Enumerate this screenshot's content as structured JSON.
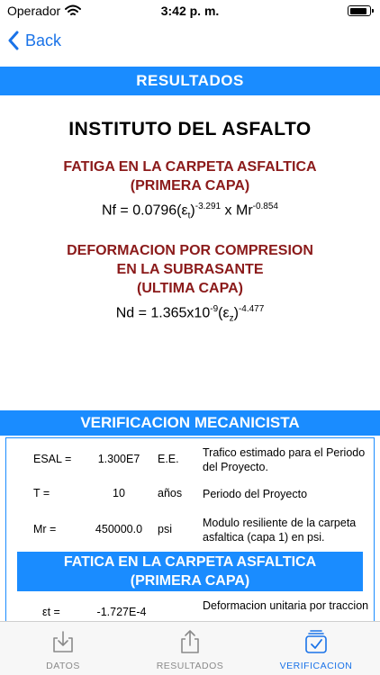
{
  "status": {
    "carrier": "Operador",
    "time": "3:42 p. m."
  },
  "nav": {
    "back_label": "Back"
  },
  "header": {
    "title": "RESULTADOS"
  },
  "content": {
    "institute": "INSTITUTO DEL ASFALTO",
    "fatigue": {
      "heading_line1": "FATIGA EN LA CARPETA ASFALTICA",
      "heading_line2": "(PRIMERA CAPA)",
      "f_prefix": "Nf = 0.0796(ε",
      "f_sub": "t",
      "f_paren": ")",
      "f_exp1": "-3.291",
      "f_mid": " x Mr",
      "f_exp2": "-0.854"
    },
    "deformation": {
      "heading_line1": "DEFORMACION POR COMPRESION",
      "heading_line2": "EN LA SUBRASANTE",
      "heading_line3": "(ULTIMA CAPA)",
      "f_prefix": "Nd = 1.365x10",
      "f_exp1": "-9",
      "f_open": "(ε",
      "f_sub": "z",
      "f_close": ")",
      "f_exp2": "-4.477"
    }
  },
  "verification": {
    "title": "VERIFICACION MECANICISTA",
    "rows": [
      {
        "label": "ESAL =",
        "value": "1.300E7",
        "unit": "E.E.",
        "desc": "Trafico estimado para el Periodo del Proyecto."
      },
      {
        "label": "T =",
        "value": "10",
        "unit": "años",
        "desc": "Periodo del Proyecto"
      },
      {
        "label": "Mr =",
        "value": "450000.0",
        "unit": "psi",
        "desc": "Modulo resiliente de la carpeta asfaltica (capa 1) en psi."
      }
    ],
    "fatigue_title_line1": "FATICA EN LA CARPETA ASFALTICA",
    "fatigue_title_line2": "(PRIMERA CAPA)",
    "strain_row": {
      "label": "εt =",
      "value": "-1.727E-4",
      "desc": "Deformacion unitaria por traccion"
    }
  },
  "tabs": [
    {
      "label": "DATOS",
      "icon": "download-tray-icon",
      "active": false
    },
    {
      "label": "RESULTADOS",
      "icon": "share-upload-icon",
      "active": false
    },
    {
      "label": "VERIFICACION",
      "icon": "checkbox-stack-icon",
      "active": true
    }
  ],
  "colors": {
    "accent": "#1a8cff",
    "link": "#1a73e8",
    "heading_red": "#8b1a1a",
    "tab_inactive": "#8a8a8a"
  },
  "battery_level": 0.9
}
